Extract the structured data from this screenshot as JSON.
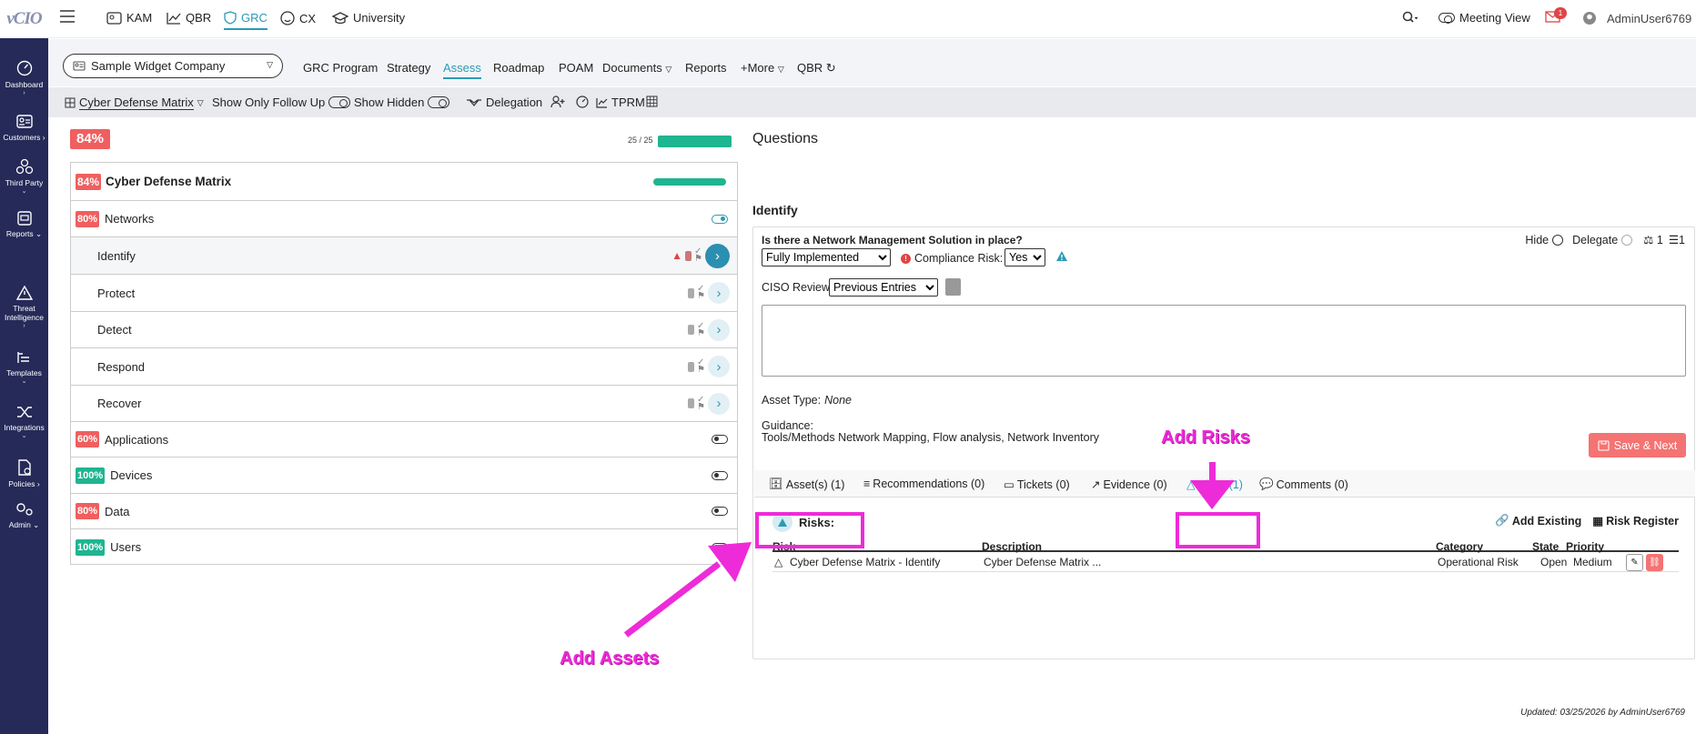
{
  "logo_text": "vCIO",
  "nav": [
    {
      "label": "Dashboard",
      "icon": "dashboard-icon"
    },
    {
      "label": "Customers",
      "icon": "customers-icon"
    },
    {
      "label": "Third Party",
      "icon": "third-party-icon"
    },
    {
      "label": "Reports",
      "icon": "reports-icon"
    },
    {
      "label": "Threat Intelligence",
      "icon": "threat-intelligence-icon"
    },
    {
      "label": "Templates",
      "icon": "templates-icon"
    },
    {
      "label": "Integrations",
      "icon": "integrations-icon"
    },
    {
      "label": "Policies",
      "icon": "policies-icon"
    },
    {
      "label": "Admin",
      "icon": "admin-icon"
    }
  ],
  "topbar": {
    "modules": [
      "KAM",
      "QBR",
      "GRC",
      "CX",
      "University"
    ],
    "active_module": "GRC",
    "meeting_view": "Meeting View",
    "notification_count": "1",
    "username": "AdminUser6769"
  },
  "subnav": {
    "company": "Sample Widget Company",
    "items": [
      "GRC Program",
      "Strategy",
      "Assess",
      "Roadmap",
      "POAM",
      "Documents",
      "Reports",
      "+More",
      "QBR"
    ],
    "active": "Assess"
  },
  "toolbar": {
    "framework": "Cyber Defense Matrix",
    "follow_up": "Show Only Follow Up",
    "hidden": "Show Hidden",
    "delegation": "Delegation",
    "tprm": "TPRM"
  },
  "overall": {
    "score": "84%",
    "progress_text": "25 / 25",
    "progress": 1.0
  },
  "matrix": {
    "title": "Cyber Defense Matrix",
    "score": "84%",
    "rows": [
      {
        "label": "Networks",
        "score": "80%",
        "kind": "category",
        "color": "#ef5f5f"
      },
      {
        "label": "Identify",
        "kind": "sub"
      },
      {
        "label": "Protect",
        "kind": "sub"
      },
      {
        "label": "Detect",
        "kind": "sub"
      },
      {
        "label": "Respond",
        "kind": "sub"
      },
      {
        "label": "Recover",
        "kind": "sub"
      },
      {
        "label": "Applications",
        "score": "60%",
        "kind": "category",
        "color": "#ef5f5f"
      },
      {
        "label": "Devices",
        "score": "100%",
        "kind": "category",
        "color": "#1fb590"
      },
      {
        "label": "Data",
        "score": "80%",
        "kind": "category",
        "color": "#ef5f5f"
      },
      {
        "label": "Users",
        "score": "100%",
        "kind": "category",
        "color": "#1fb590"
      }
    ]
  },
  "questions": {
    "title": "Questions",
    "section": "Identify",
    "question": "Is there a Network Management Solution in place?",
    "hide": "Hide",
    "delegate": "Delegate",
    "count_a": "1",
    "count_b": "1",
    "answer": "Fully Implemented",
    "compliance_label": "Compliance Risk:",
    "compliance_value": "Yes",
    "ciso_label": "CISO Review:",
    "ciso_value": "Previous Entries",
    "asset_type_label": "Asset Type:",
    "asset_type_value": "None",
    "guidance_label": "Guidance:",
    "guidance_text": "Tools/Methods Network Mapping, Flow analysis, Network Inventory",
    "save_next": "Save & Next",
    "updated": "Updated: 03/25/2026 by AdminUser6769"
  },
  "tabs": {
    "assets": "Asset(s) (1)",
    "recommendations": "Recommendations (0)",
    "tickets": "Tickets (0)",
    "evidence": "Evidence (0)",
    "risks": "Risks (1)",
    "comments": "Comments (0)"
  },
  "risks": {
    "header": "Risks:",
    "add_existing": "Add Existing",
    "register": "Risk Register",
    "columns": [
      "Risk",
      "Description",
      "Category",
      "State",
      "Priority"
    ],
    "rows": [
      {
        "risk": "Cyber Defense Matrix - Identify",
        "description": "Cyber Defense Matrix ...",
        "category": "Operational Risk",
        "state": "Open",
        "priority": "Medium"
      }
    ]
  },
  "annotations": {
    "add_risks": "Add Risks",
    "add_assets": "Add Assets"
  },
  "colors": {
    "nav_bg": "#252a58",
    "accent": "#2a9bb5",
    "red": "#ef5f5f",
    "green": "#1fb590",
    "annotation": "#ee2bd8"
  }
}
